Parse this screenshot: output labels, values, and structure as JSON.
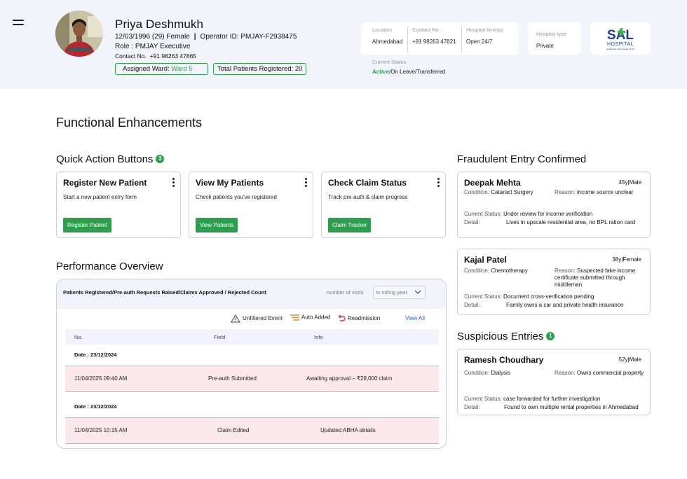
{
  "profile": {
    "name": "Priya Deshmukh",
    "dob_gender": "12/03/1996 (29) Female",
    "operator_id": "Operator ID: PMJAY-F2938475",
    "role": "Role : PMJAY Executive",
    "contact_label": "Contact No.",
    "contact_value": "+91 98263 47865",
    "assigned_ward_label": "Assigned Ward:",
    "assigned_ward_value": "Ward 5",
    "total_registered": "Total Patients Registered: 20"
  },
  "hospital": {
    "location_label": "Location",
    "location_value": "Ahmedabad",
    "contact_label": "Contact No.",
    "contact_value": "+91 98263 47821",
    "timings_label": "Hospital timings",
    "timings_value": "Open 24/7",
    "type_label": "Hospital type",
    "type_value": "Private",
    "status_label": "Current Status",
    "status_active": "Active",
    "status_rest": "/On Leave/Transferred",
    "logo_text": "SAL",
    "logo_sub": "HOSPITAL",
    "logo_tag": "Healthcare with Human Touch"
  },
  "page": {
    "title": "Functional Enhancements"
  },
  "quick_actions": {
    "title": "Quick Action Buttons",
    "count": "3",
    "items": [
      {
        "title": "Register New Patient",
        "desc": "Start a new patient entry form",
        "button": "Register Patient"
      },
      {
        "title": "View My Patients",
        "desc": "Check patients you've registered",
        "button": "View Patients"
      },
      {
        "title": "Check Claim Status",
        "desc": "Track pre-auth & claim progress",
        "button": "Claim Tracker"
      }
    ]
  },
  "performance": {
    "title": "Performance Overview",
    "header": "Patients Registered/Pre-auth Requests Raised/Claims Approved / Rejected Count",
    "filter_label": "number of visits",
    "filter_value": "In rolling year",
    "legend": {
      "unfiltered": "Unfiltered Event",
      "auto": "Auto Added",
      "readmission": "Readmission"
    },
    "view_all": "View All",
    "columns": [
      "No.",
      "Field",
      "Info"
    ],
    "groups": [
      {
        "date": "Date : 23/12/2024",
        "row": {
          "time": "11/04/2025  09:40 AM",
          "field": "Pre-auth Submitted",
          "info": "Awaiting approval – ₹28,000 claim"
        }
      },
      {
        "date": "Date : 23/12/2024",
        "row": {
          "time": "11/04/2025  10:15 AM",
          "field": "Claim Edited",
          "info": "Updated ABHA details"
        }
      }
    ]
  },
  "fraud": {
    "title": "Fraudulent Entry Confirmed",
    "entries": [
      {
        "name": "Deepak Mehta",
        "age": "45y|Male",
        "condition_label": "Condition:",
        "condition": "Cataract Surgery",
        "reason_label": "Reason:",
        "reason": "income source unclear",
        "status_label": "Current Status:",
        "status": "Under review for income verification",
        "detail_label": "Detail:",
        "detail": "Lives in upscale residential area, no BPL ration card"
      },
      {
        "name": "Kajal Patel",
        "age": "38y|Female",
        "condition_label": "Condition:",
        "condition": "Chemotherapy",
        "reason_label": "Reason:",
        "reason": "Suspected fake income certificate submitted through middleman",
        "status_label": "Current Status:",
        "status": "Document cross-verification pending",
        "detail_label": "Detail:",
        "detail": "Family owns a car and private health insurance"
      }
    ]
  },
  "suspicious": {
    "title": "Suspicious Entries",
    "count": "1",
    "entries": [
      {
        "name": "Ramesh Choudhary",
        "age": "52y|Male",
        "condition_label": "Condition:",
        "condition": "Dialysis",
        "reason_label": "Reason:",
        "reason": "Owns commercial property",
        "status_label": "Current Status:",
        "status": "case forwarded for further investigation",
        "detail_label": "Detail:",
        "detail": "Found to own multiple rental properties in Ahmedabad"
      }
    ]
  },
  "colors": {
    "accent_green": "#2e9d4e",
    "header_bg": "#f2f3fb",
    "row_highlight": "#fce8ea",
    "link_blue": "#2b5fd9",
    "logo_blue": "#1f3f8f",
    "logo_green": "#3bb54a"
  },
  "icons": [
    "hamburger-menu-icon",
    "more-vertical-icon",
    "warning-triangle-icon",
    "auto-added-lines-icon",
    "readmission-undo-icon",
    "chevron-down-icon"
  ]
}
